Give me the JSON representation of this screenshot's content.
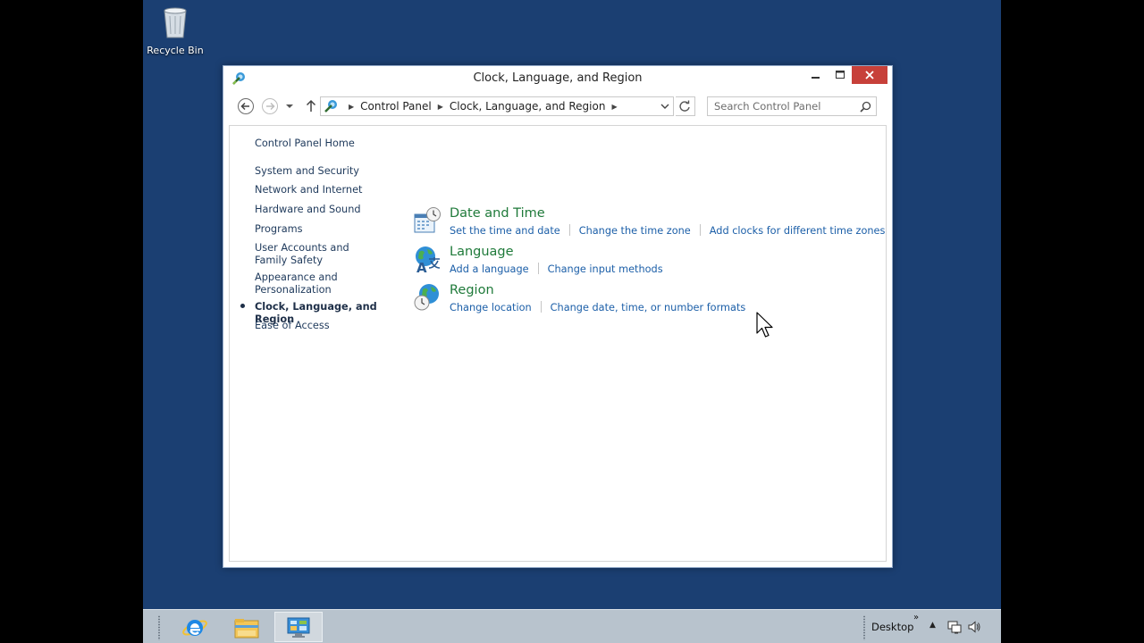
{
  "desktop": {
    "recycle_bin_label": "Recycle Bin"
  },
  "window": {
    "title": "Clock, Language, and Region",
    "app_icon": "control-panel-icon"
  },
  "address_bar": {
    "breadcrumbs": [
      "Control Panel",
      "Clock, Language, and Region"
    ]
  },
  "search": {
    "placeholder": "Search Control Panel"
  },
  "left_nav": {
    "home": "Control Panel Home",
    "items": [
      {
        "label": "System and Security"
      },
      {
        "label": "Network and Internet"
      },
      {
        "label": "Hardware and Sound"
      },
      {
        "label": "Programs"
      },
      {
        "label": "User Accounts and Family Safety"
      },
      {
        "label": "Appearance and Personalization"
      },
      {
        "label": "Clock, Language, and Region",
        "current": true
      },
      {
        "label": "Ease of Access"
      }
    ]
  },
  "categories": [
    {
      "title": "Date and Time",
      "icon": "calendar-clock-icon",
      "links": [
        "Set the time and date",
        "Change the time zone",
        "Add clocks for different time zones"
      ]
    },
    {
      "title": "Language",
      "icon": "globe-language-icon",
      "links": [
        "Add a language",
        "Change input methods"
      ]
    },
    {
      "title": "Region",
      "icon": "globe-clock-icon",
      "links": [
        "Change location",
        "Change date, time, or number formats"
      ]
    }
  ],
  "taskbar": {
    "pinned": [
      "internet-explorer-icon",
      "file-explorer-icon",
      "control-panel-icon"
    ],
    "desktop_label": "Desktop",
    "toolbar_chevron": "»"
  },
  "colors": {
    "desktop_bg": "#1b3f72",
    "category_title": "#1f7a3a",
    "link": "#1c5fa8",
    "close_button": "#c7403a",
    "taskbar": "#b8c3cd"
  }
}
